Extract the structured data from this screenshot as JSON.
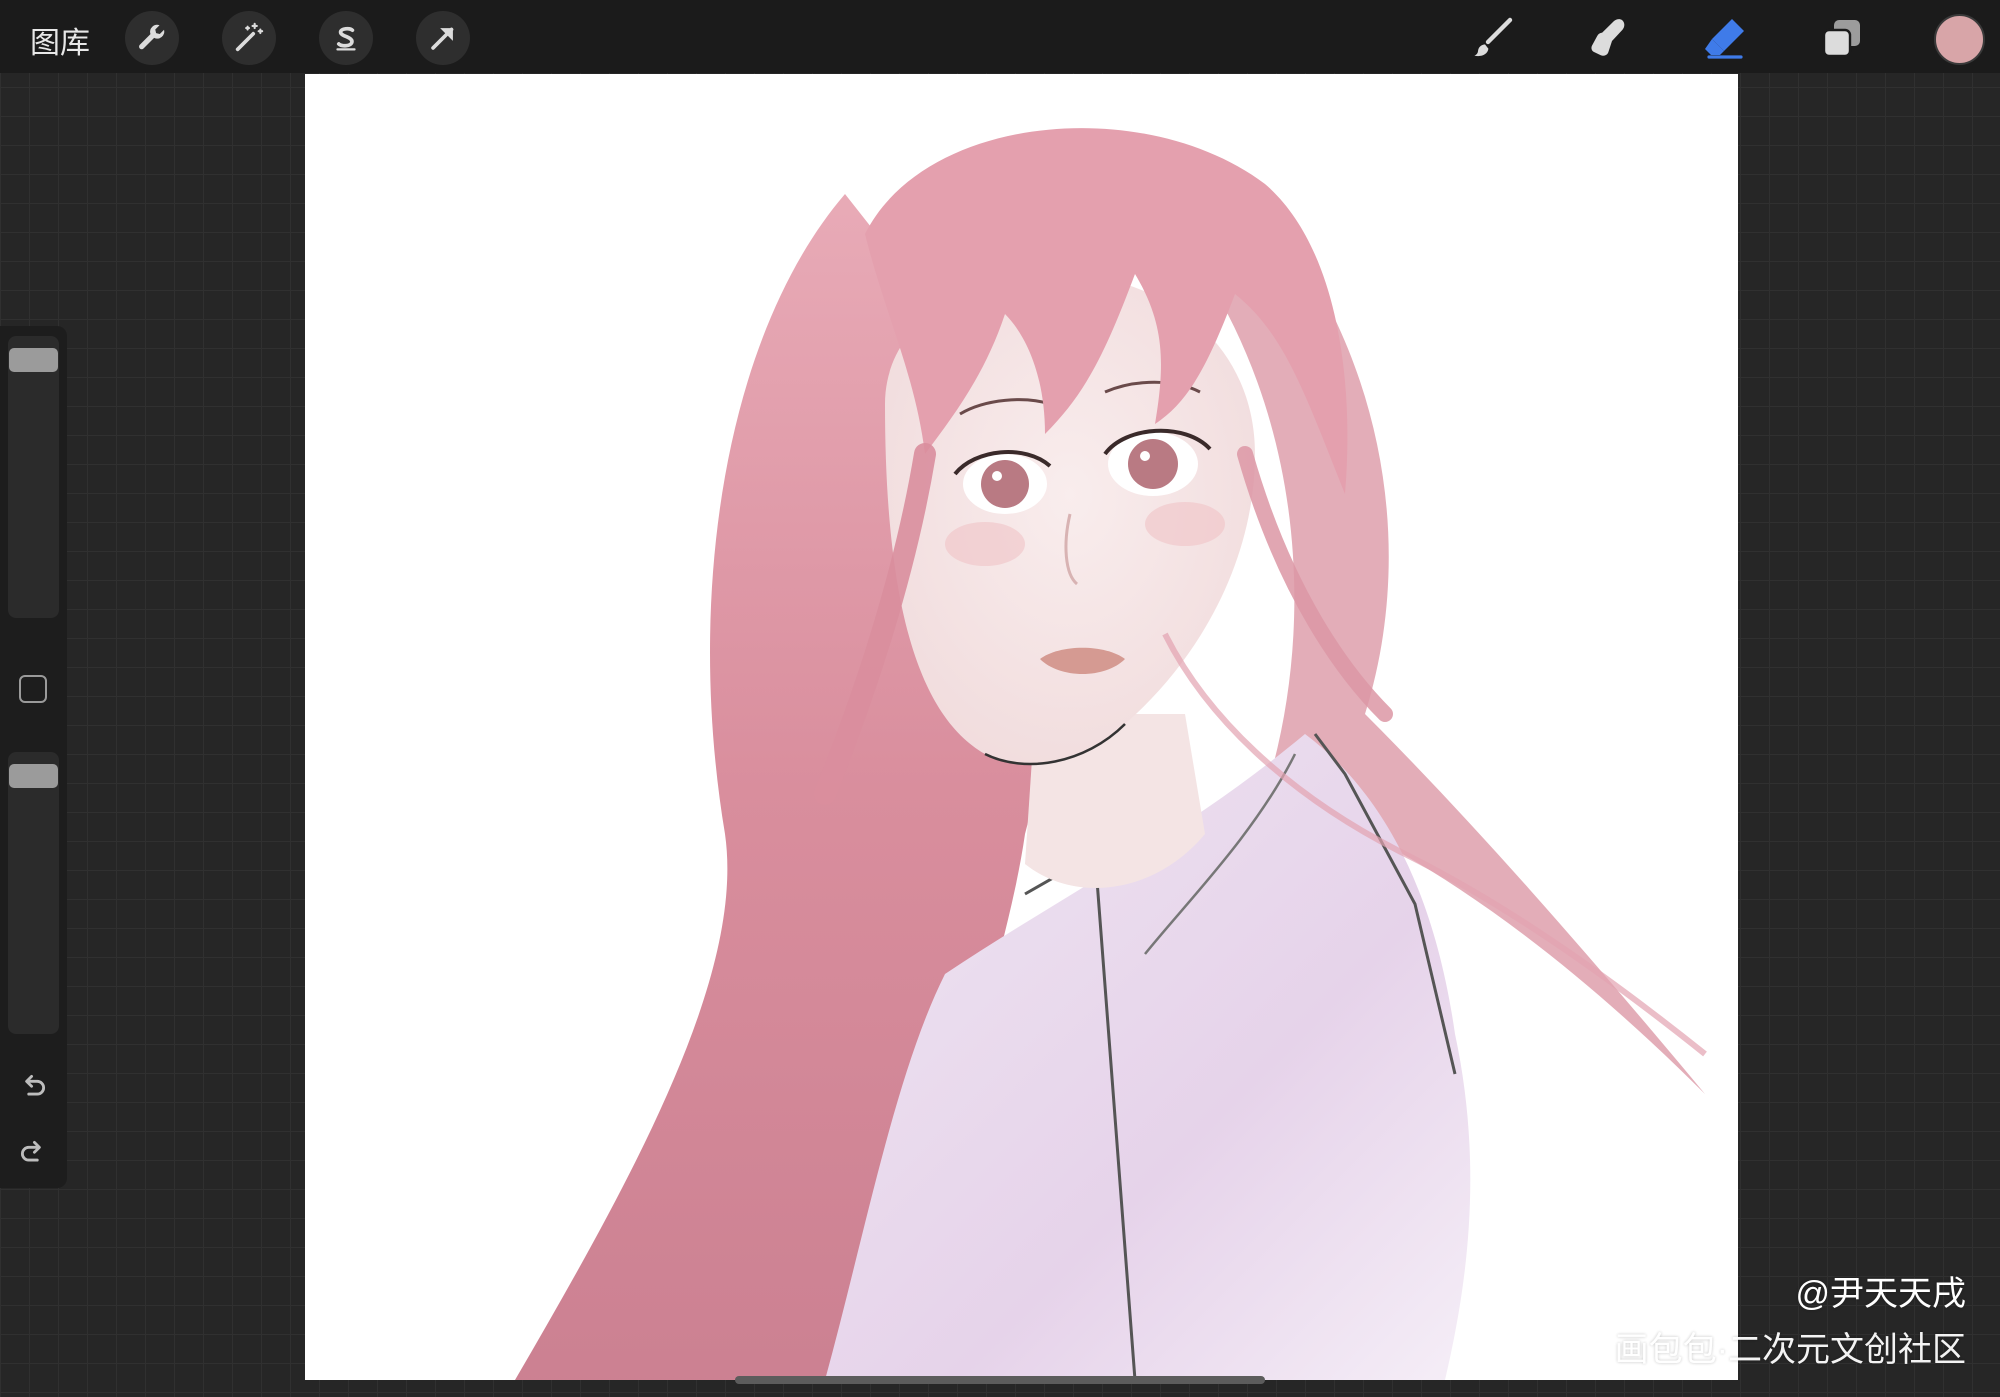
{
  "topbar": {
    "gallery_label": "图库",
    "left_tools": [
      {
        "name": "actions",
        "icon": "wrench-icon"
      },
      {
        "name": "adjustments",
        "icon": "magic-wand-icon"
      },
      {
        "name": "selection",
        "icon": "selection-s-icon"
      },
      {
        "name": "transform",
        "icon": "arrow-icon"
      }
    ],
    "right_tools": [
      {
        "name": "brush",
        "icon": "brush-icon"
      },
      {
        "name": "smudge",
        "icon": "smudge-finger-icon"
      },
      {
        "name": "eraser",
        "icon": "eraser-icon",
        "active": true
      },
      {
        "name": "layers",
        "icon": "layers-icon"
      }
    ],
    "current_color": "#d8a5a8",
    "active_tool_color": "#3f7be9"
  },
  "sidebar": {
    "brush_size_fraction": 1.0,
    "opacity_fraction": 1.0,
    "modify_icon": "square-icon",
    "undo_icon": "undo-icon",
    "redo_icon": "redo-icon"
  },
  "watermark": {
    "author": "@尹天天戌",
    "site": "画包包·二次元文创社区"
  }
}
